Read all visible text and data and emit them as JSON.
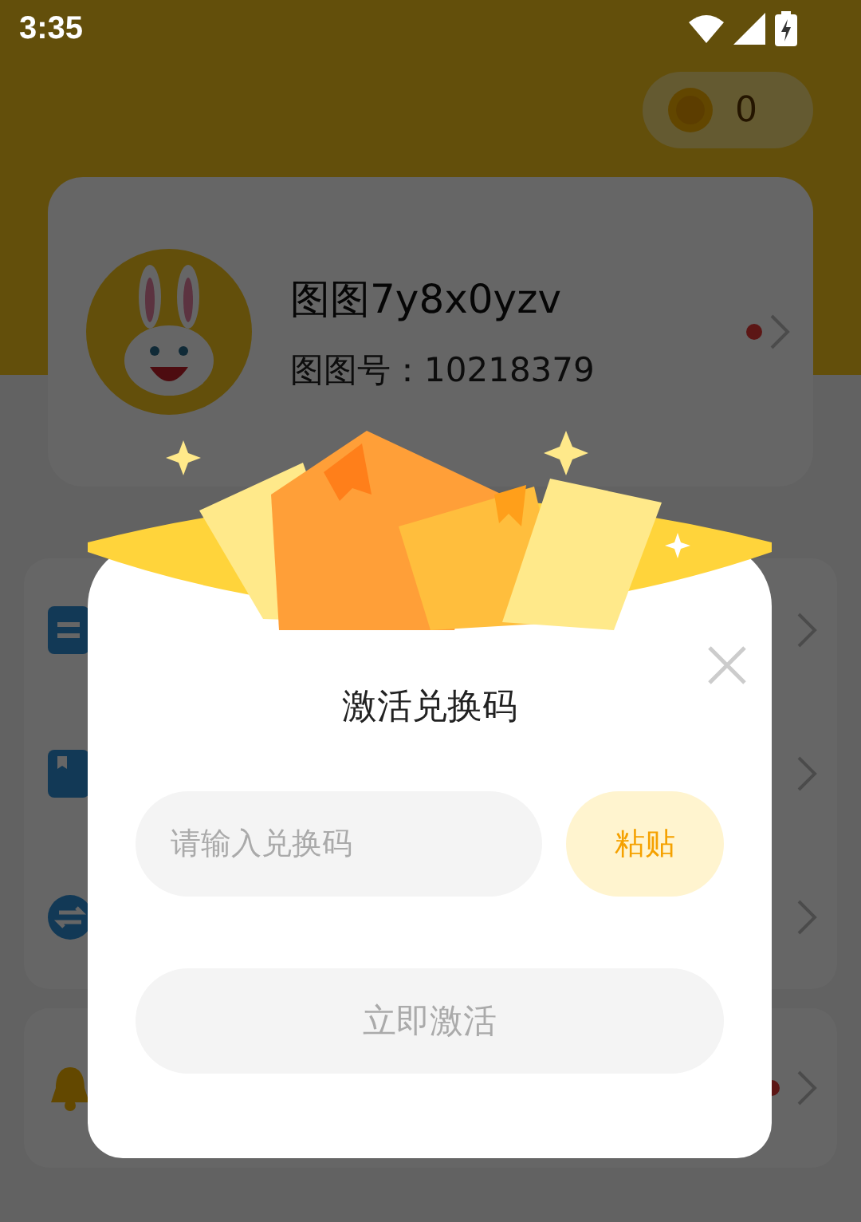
{
  "status_bar": {
    "time": "3:35"
  },
  "coins": {
    "count": "0"
  },
  "profile": {
    "name": "图图7y8x0yzv",
    "id_label": "图图号：10218379",
    "unread": true
  },
  "menu": [
    {
      "kind": "doc",
      "unread": false
    },
    {
      "kind": "book",
      "unread": false
    },
    {
      "kind": "exchange",
      "unread": false
    },
    {
      "kind": "bell",
      "unread": true
    }
  ],
  "dialog": {
    "title": "激活兑换码",
    "code_field": {
      "placeholder": "请输入兑换码"
    },
    "paste_button": "粘贴",
    "activate_button": {
      "label": "立即激活",
      "disabled": true
    }
  }
}
